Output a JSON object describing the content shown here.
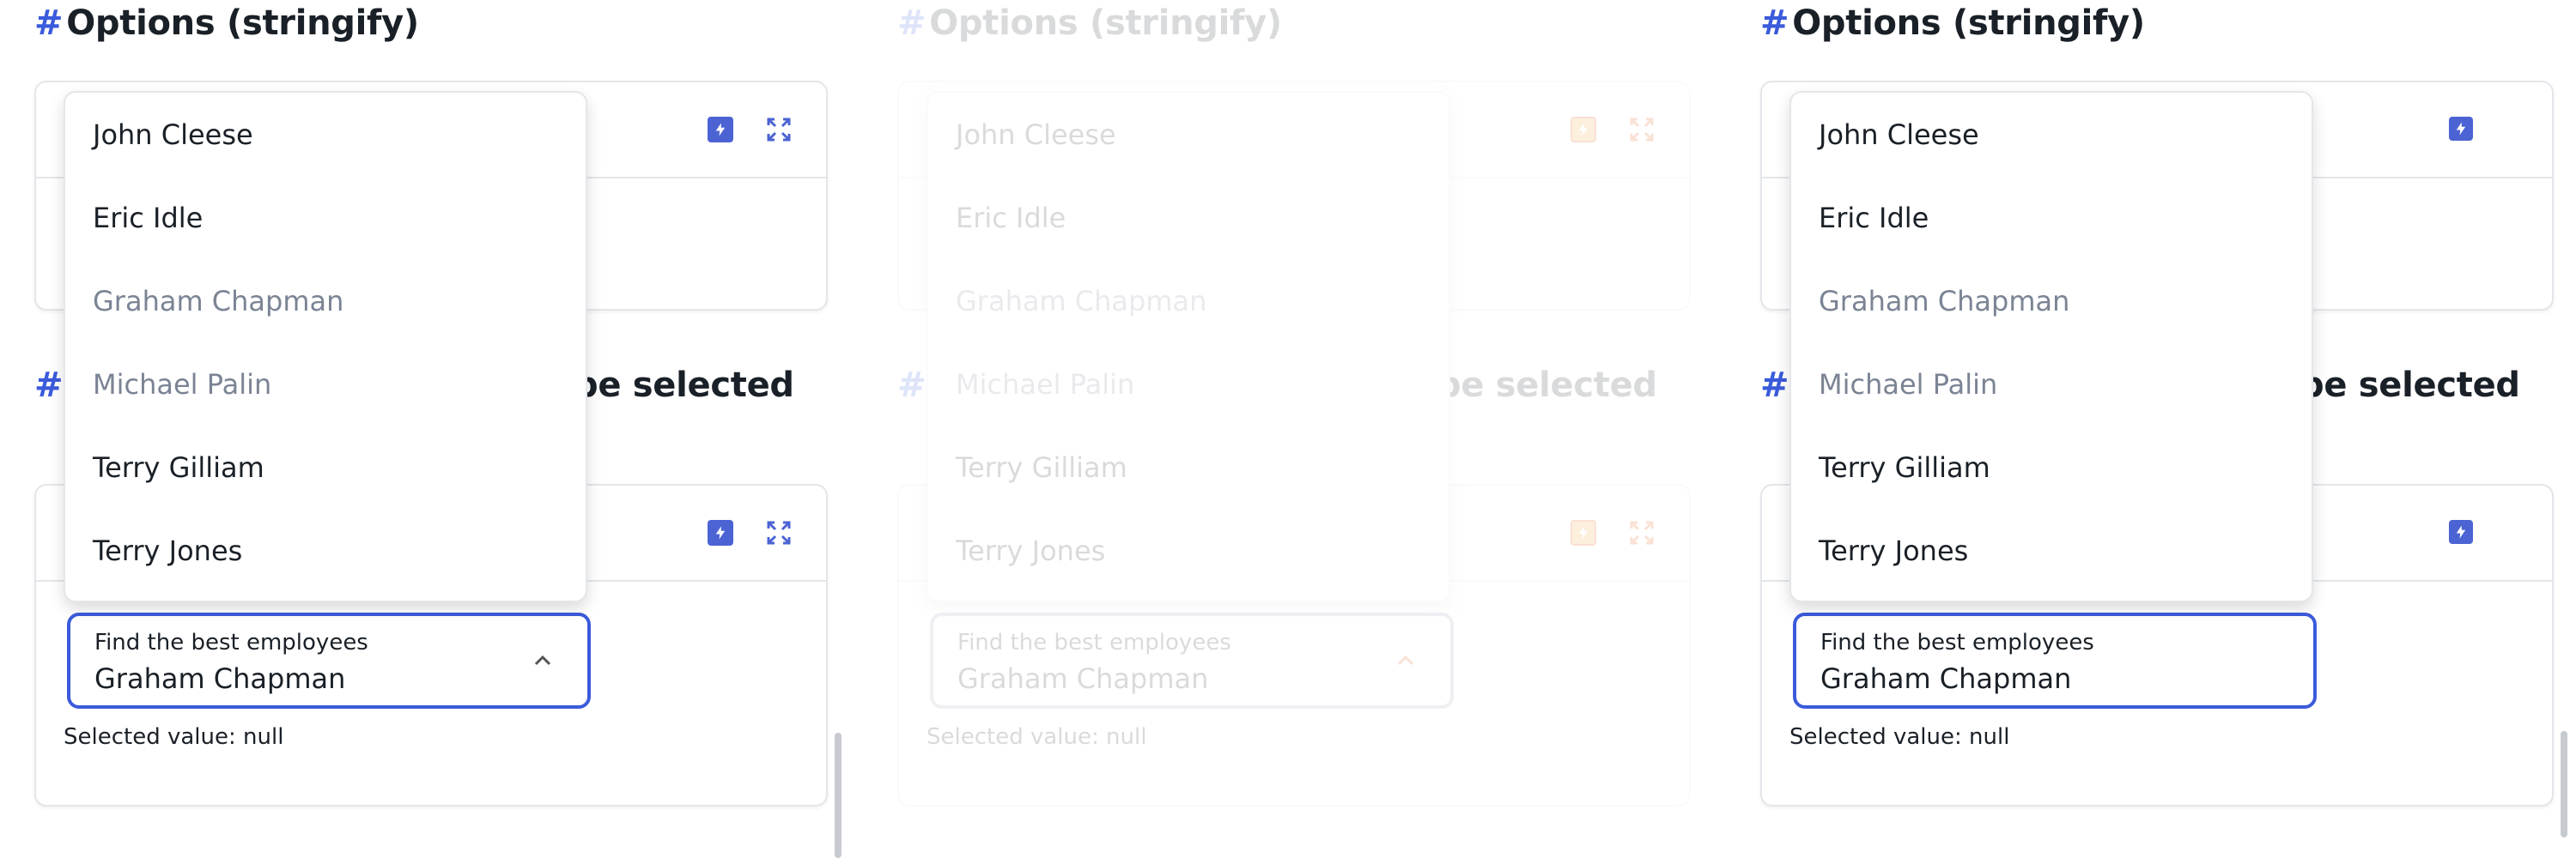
{
  "section1_title": "Options (stringify)",
  "section2_title_visible": "be selected",
  "hash": "#",
  "select_label": "Find the best employees",
  "select_value": "Graham Chapman",
  "selected_value_text": "Selected value: null",
  "options": [
    {
      "label": "John Cleese",
      "disabled": false
    },
    {
      "label": "Eric Idle",
      "disabled": false
    },
    {
      "label": "Graham Chapman",
      "disabled": true
    },
    {
      "label": "Michael Palin",
      "disabled": true
    },
    {
      "label": "Terry Gilliam",
      "disabled": false
    },
    {
      "label": "Terry Jones",
      "disabled": false
    }
  ],
  "colors": {
    "accent": "#3b5bdb",
    "text": "#1a2027",
    "muted": "#7b8494",
    "border": "#e3e6ea",
    "ghost_accent": "#e04b00"
  },
  "icons": [
    "bolt-icon",
    "expand-icon",
    "chevron-up-icon"
  ]
}
